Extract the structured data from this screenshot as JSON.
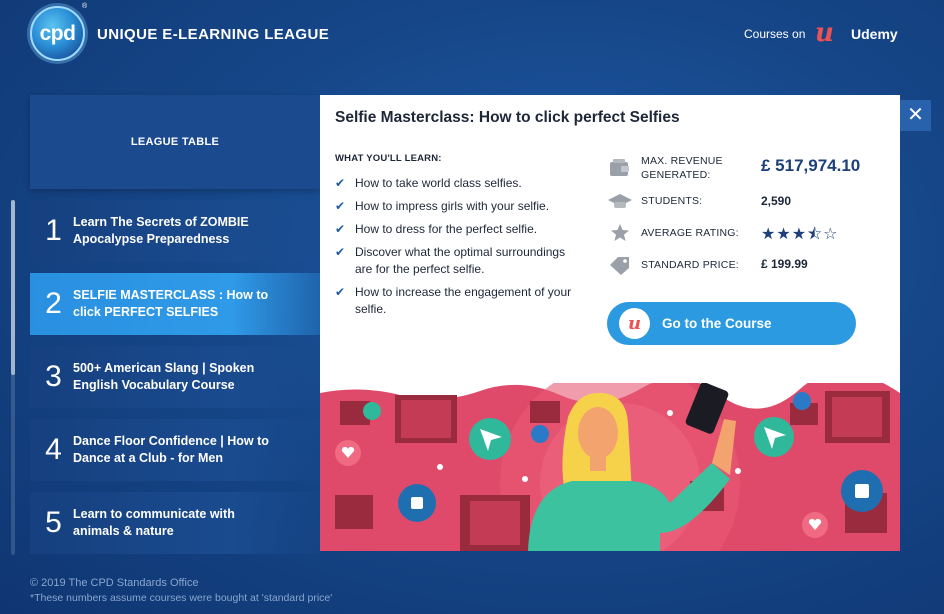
{
  "header": {
    "logo_text": "cpd",
    "logo_mark": "®",
    "title": "UNIQUE E-LEARNING LEAGUE",
    "courses_on": "Courses on",
    "udemy_logo": "u",
    "udemy_label": "Udemy"
  },
  "sidebar": {
    "league_table_label": "LEAGUE TABLE",
    "items": [
      {
        "num": "1",
        "title": "Learn The Secrets of ZOMBIE Apocalypse Preparedness"
      },
      {
        "num": "2",
        "title": "SELFIE MASTERCLASS : How to click PERFECT SELFIES"
      },
      {
        "num": "3",
        "title": "500+ American Slang | Spoken English Vocabulary Course"
      },
      {
        "num": "4",
        "title": "Dance Floor Confidence | How to Dance at a Club - for Men"
      },
      {
        "num": "5",
        "title": "Learn to communicate with animals & nature"
      }
    ],
    "active_index": 1
  },
  "modal": {
    "close_glyph": "✕",
    "title": "Selfie Masterclass: How to click perfect Selfies",
    "learn_heading": "WHAT YOU'LL LEARN:",
    "learn_items": [
      "How to take world class selfies.",
      "How to impress girls with your selfie.",
      "How to dress for the perfect selfie.",
      "Discover what the optimal surroundings are for the perfect selfie.",
      "How to increase the engagement of your selfie."
    ],
    "stats": {
      "revenue_label": "MAX. REVENUE GENERATED:",
      "revenue_value": "£ 517,974.10",
      "students_label": "STUDENTS:",
      "students_value": "2,590",
      "rating_label": "AVERAGE RATING:",
      "rating_value": 3.5,
      "rating_max": 5,
      "rating_stars": "★★★⯪☆",
      "price_label": "STANDARD PRICE:",
      "price_value": "£ 199.99"
    },
    "cta_badge": "u",
    "cta_label": "Go to the Course"
  },
  "footer": {
    "copyright": "© 2019 The CPD Standards Office",
    "note": "*These numbers assume courses were bought at 'standard price'"
  },
  "colors": {
    "background": "#164789",
    "accent_blue": "#2b9ae0",
    "active_item": "#2f9ae8",
    "udemy_red": "#ec5252",
    "illustration_pink": "#e04a6a",
    "illustration_top": "#f25f7a"
  }
}
